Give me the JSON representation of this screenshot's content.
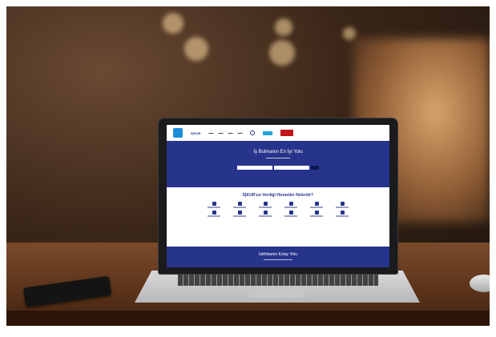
{
  "website": {
    "hero_title": "İş Bulmanın En İyi Yolu",
    "services_heading": "İŞKUR'un Verdiği Hizmetler Nelerdir?",
    "footer_title": "İstihdamın Kolay Yolu"
  },
  "icons": {
    "site_logo": "iskur-logo",
    "search": "search-icon",
    "service": "service-icon"
  },
  "colors": {
    "site_primary": "#27348b",
    "site_accent": "#22a3dc",
    "badge_red": "#c4161c"
  }
}
